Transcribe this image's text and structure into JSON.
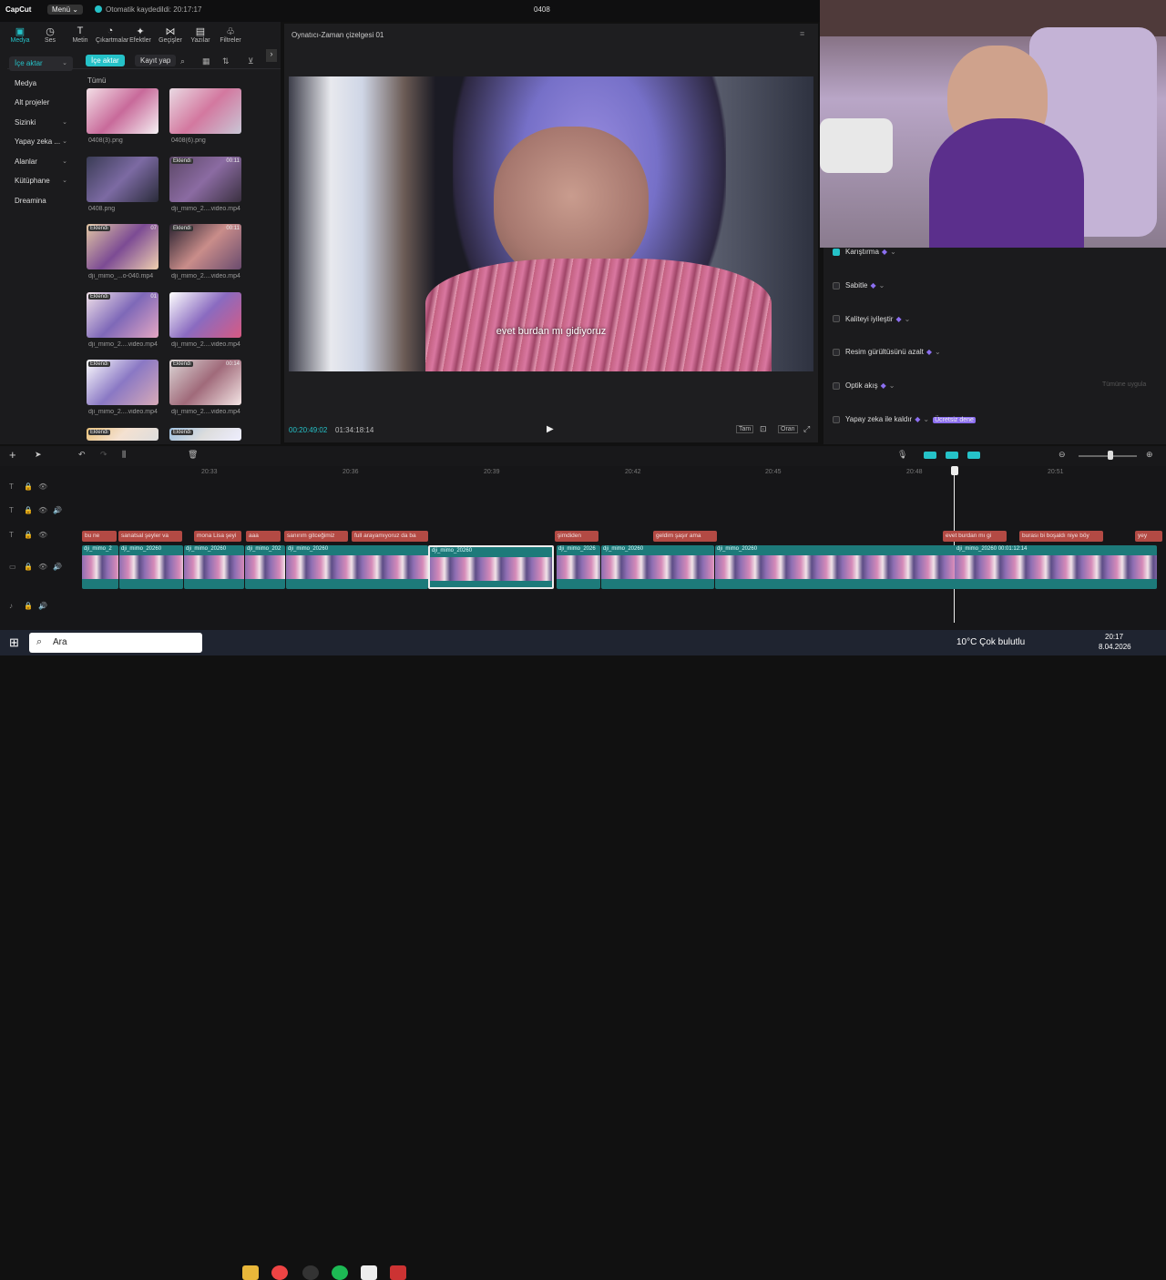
{
  "titlebar": {
    "logo": "CapCut",
    "menu": "Menü",
    "autosave": "Otomatik kaydedildi: 20:17:17",
    "project": "0408"
  },
  "tabs": [
    {
      "label": "Medya",
      "icon": "media-icon"
    },
    {
      "label": "Ses",
      "icon": "audio-icon"
    },
    {
      "label": "Metin",
      "icon": "text-icon"
    },
    {
      "label": "Çıkartmalar",
      "icon": "sticker-icon"
    },
    {
      "label": "Efektler",
      "icon": "effects-icon"
    },
    {
      "label": "Geçişler",
      "icon": "transitions-icon"
    },
    {
      "label": "Yazılar",
      "icon": "captions-icon"
    },
    {
      "label": "Filtreler",
      "icon": "filters-icon"
    }
  ],
  "sidebar": [
    {
      "label": "İçe aktar"
    },
    {
      "label": "Medya"
    },
    {
      "label": "Alt projeler"
    },
    {
      "label": "Sizinki"
    },
    {
      "label": "Yapay zeka ..."
    },
    {
      "label": "Alanlar"
    },
    {
      "label": "Kütüphane"
    },
    {
      "label": "Dreamina"
    }
  ],
  "media": {
    "import_label": "İçe aktar",
    "record_label": "Kayıt yap",
    "section": "Tümü",
    "items": [
      {
        "name": "0408(3).png",
        "badge": "",
        "dur": ""
      },
      {
        "name": "0408(6).png",
        "badge": "",
        "dur": ""
      },
      {
        "name": "0408.png",
        "badge": "",
        "dur": ""
      },
      {
        "name": "dji_mimo_2....video.mp4",
        "badge": "Eklendi",
        "dur": "00:11"
      },
      {
        "name": "dji_mimo_...o-040.mp4",
        "badge": "Eklendi",
        "dur": "07"
      },
      {
        "name": "dji_mimo_2....video.mp4",
        "badge": "Eklendi",
        "dur": "00:11"
      },
      {
        "name": "dji_mimo_2....video.mp4",
        "badge": "Eklendi",
        "dur": "01"
      },
      {
        "name": "dji_mimo_2....video.mp4",
        "badge": "",
        "dur": ""
      },
      {
        "name": "dji_mimo_2....video.mp4",
        "badge": "Eklendi",
        "dur": ""
      },
      {
        "name": "dji_mimo_2....video.mp4",
        "badge": "Eklendi",
        "dur": "00:14"
      },
      {
        "name": "",
        "badge": "Eklendi",
        "dur": ""
      },
      {
        "name": "",
        "badge": "Eklendi",
        "dur": ""
      }
    ]
  },
  "player": {
    "title": "Oynatıcı-Zaman çizelgesi 01",
    "subtitle": "evet burdan mı gidiyoruz",
    "current": "00:20:49:02",
    "total": "01:34:18:14",
    "full": "Tam",
    "ratio": "Oran"
  },
  "props": [
    {
      "label": "Karıştırma",
      "checked": true
    },
    {
      "label": "Sabitle",
      "checked": false
    },
    {
      "label": "Kaliteyi iyileştir",
      "checked": false
    },
    {
      "label": "Resim gürültüsünü azalt",
      "checked": false
    },
    {
      "label": "Optik akış",
      "checked": false,
      "extra": "Tümüne uygula"
    },
    {
      "label": "Yapay zeka ile kaldır",
      "checked": false,
      "tag": "Ücretsiz dene"
    }
  ],
  "ruler": [
    "20:33",
    "20:36",
    "20:39",
    "20:42",
    "20:45",
    "20:48",
    "20:51"
  ],
  "subtitles": [
    {
      "t": "bu ne"
    },
    {
      "t": "sanatsal şeyler va"
    },
    {
      "t": "mona Lisa şeyi"
    },
    {
      "t": "aaa"
    },
    {
      "t": "sanırım gitceğimiz"
    },
    {
      "t": "full arayamıyoruz da ba"
    },
    {
      "t": "şimdiden"
    },
    {
      "t": "geldim şaşır ama"
    },
    {
      "t": "evet burdan mı gi"
    },
    {
      "t": "burası bi boşaldı niye böy"
    },
    {
      "t": "yey"
    }
  ],
  "clips": [
    {
      "l": "dji_mimo_2"
    },
    {
      "l": "dji_mimo_20260"
    },
    {
      "l": "dji_mimo_20260"
    },
    {
      "l": "dji_mimo_202"
    },
    {
      "l": "dji_mimo_20260"
    },
    {
      "l": "dji_mimo_20260"
    },
    {
      "l": "dji_mimo_2026"
    },
    {
      "l": "dji_mimo_20260"
    },
    {
      "l": "dji_mimo_20260"
    },
    {
      "l": "dji_mimo_20260   00:01:12:14"
    },
    {
      "l": "dji_mimo_20260"
    }
  ],
  "taskbar": {
    "search": "Ara",
    "weather": "10°C  Çok bulutlu",
    "time": "20:17",
    "date": "8.04.2026"
  }
}
